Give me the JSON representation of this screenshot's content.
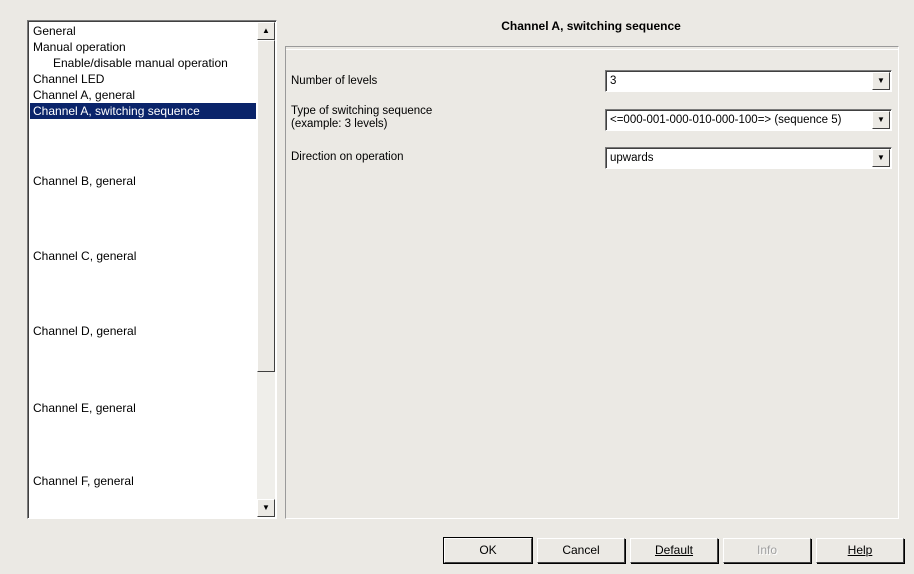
{
  "sidebar": {
    "items": [
      {
        "label": "General",
        "indent": false,
        "selected": false
      },
      {
        "label": "Manual operation",
        "indent": false,
        "selected": false
      },
      {
        "label": "Enable/disable manual operation",
        "indent": true,
        "selected": false
      },
      {
        "label": "Channel LED",
        "indent": false,
        "selected": false
      },
      {
        "label": "Channel A, general",
        "indent": false,
        "selected": false
      },
      {
        "label": "Channel A, switching sequence",
        "indent": false,
        "selected": true
      },
      {
        "label": "Channel B, general",
        "indent": false,
        "selected": false
      },
      {
        "label": "Channel C, general",
        "indent": false,
        "selected": false
      },
      {
        "label": "Channel D, general",
        "indent": false,
        "selected": false
      },
      {
        "label": "Channel E, general",
        "indent": false,
        "selected": false
      },
      {
        "label": "Channel F, general",
        "indent": false,
        "selected": false
      }
    ],
    "scroll_up_icon": "arrow-up-icon",
    "scroll_down_icon": "arrow-down-icon"
  },
  "panel": {
    "title": "Channel A, switching sequence",
    "params": [
      {
        "label_line1": "Number of levels",
        "label_line2": "",
        "value": "3"
      },
      {
        "label_line1": "Type of switching sequence",
        "label_line2": "(example: 3 levels)",
        "value": "<=000-001-000-010-000-100=> (sequence 5)"
      },
      {
        "label_line1": "Direction on operation",
        "label_line2": "",
        "value": "upwards"
      }
    ]
  },
  "buttons": {
    "ok": "OK",
    "cancel": "Cancel",
    "default_label": "Default",
    "info": "Info",
    "help": "Help"
  },
  "colors": {
    "background": "#ebe9e4",
    "selection": "#0a246a"
  }
}
